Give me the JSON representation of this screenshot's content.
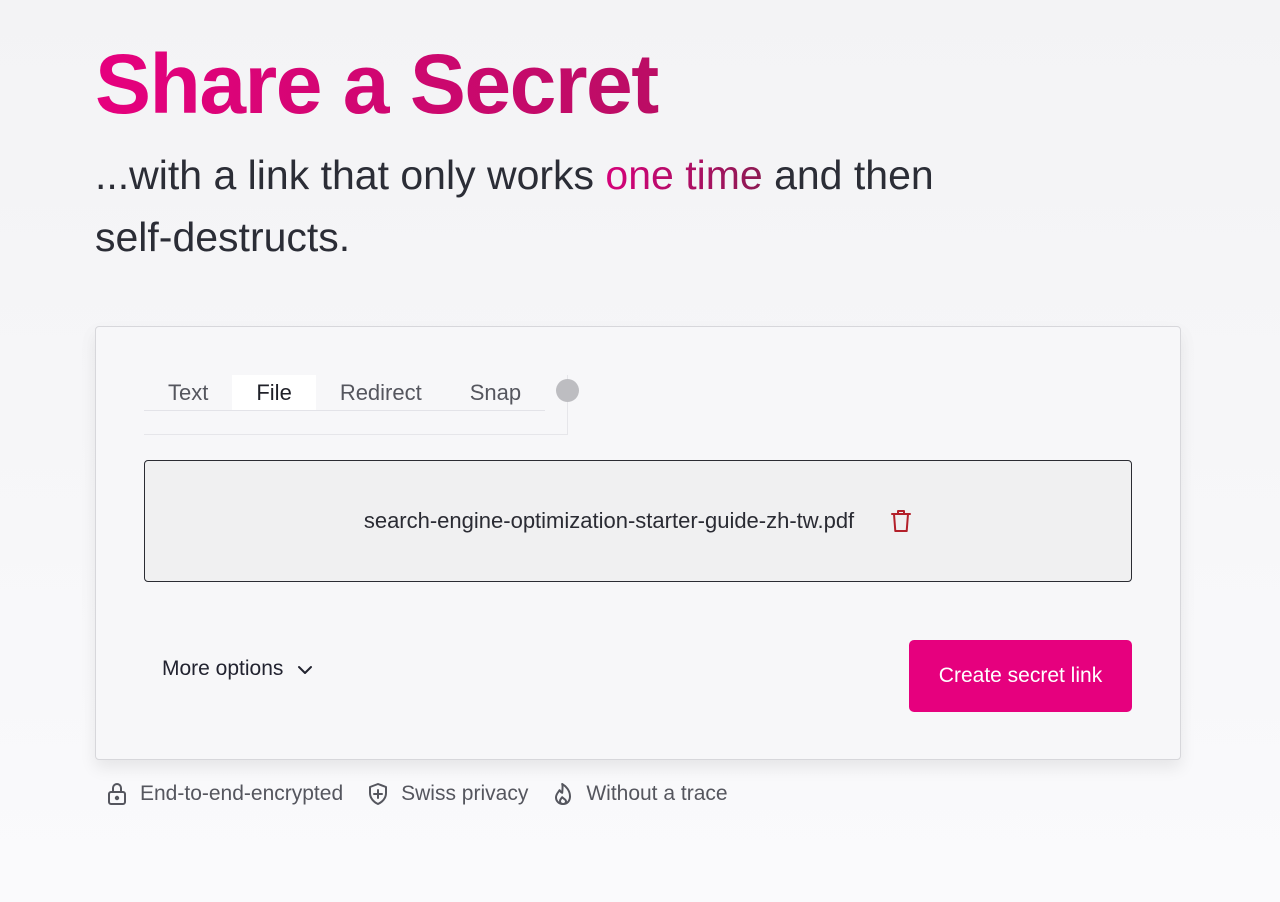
{
  "hero": {
    "title": "Share a Secret",
    "subtitle_before": "...with a link that only works ",
    "subtitle_accent": "one time",
    "subtitle_after": " and then self-destructs."
  },
  "tabs": [
    {
      "label": "Text",
      "active": false
    },
    {
      "label": "File",
      "active": true
    },
    {
      "label": "Redirect",
      "active": false
    },
    {
      "label": "Snap",
      "active": false
    }
  ],
  "file": {
    "name": "search-engine-optimization-starter-guide-zh-tw.pdf",
    "remove_icon": "trash-icon"
  },
  "actions": {
    "more_options": "More options",
    "create": "Create secret link"
  },
  "features": [
    {
      "icon": "lock-icon",
      "label": "End-to-end-encrypted"
    },
    {
      "icon": "shield-icon",
      "label": "Swiss privacy"
    },
    {
      "icon": "flame-icon",
      "label": "Without a trace"
    }
  ],
  "colors": {
    "brand": "#e6007e",
    "brand_dark": "#8c1a52",
    "trash": "#b3202a"
  }
}
